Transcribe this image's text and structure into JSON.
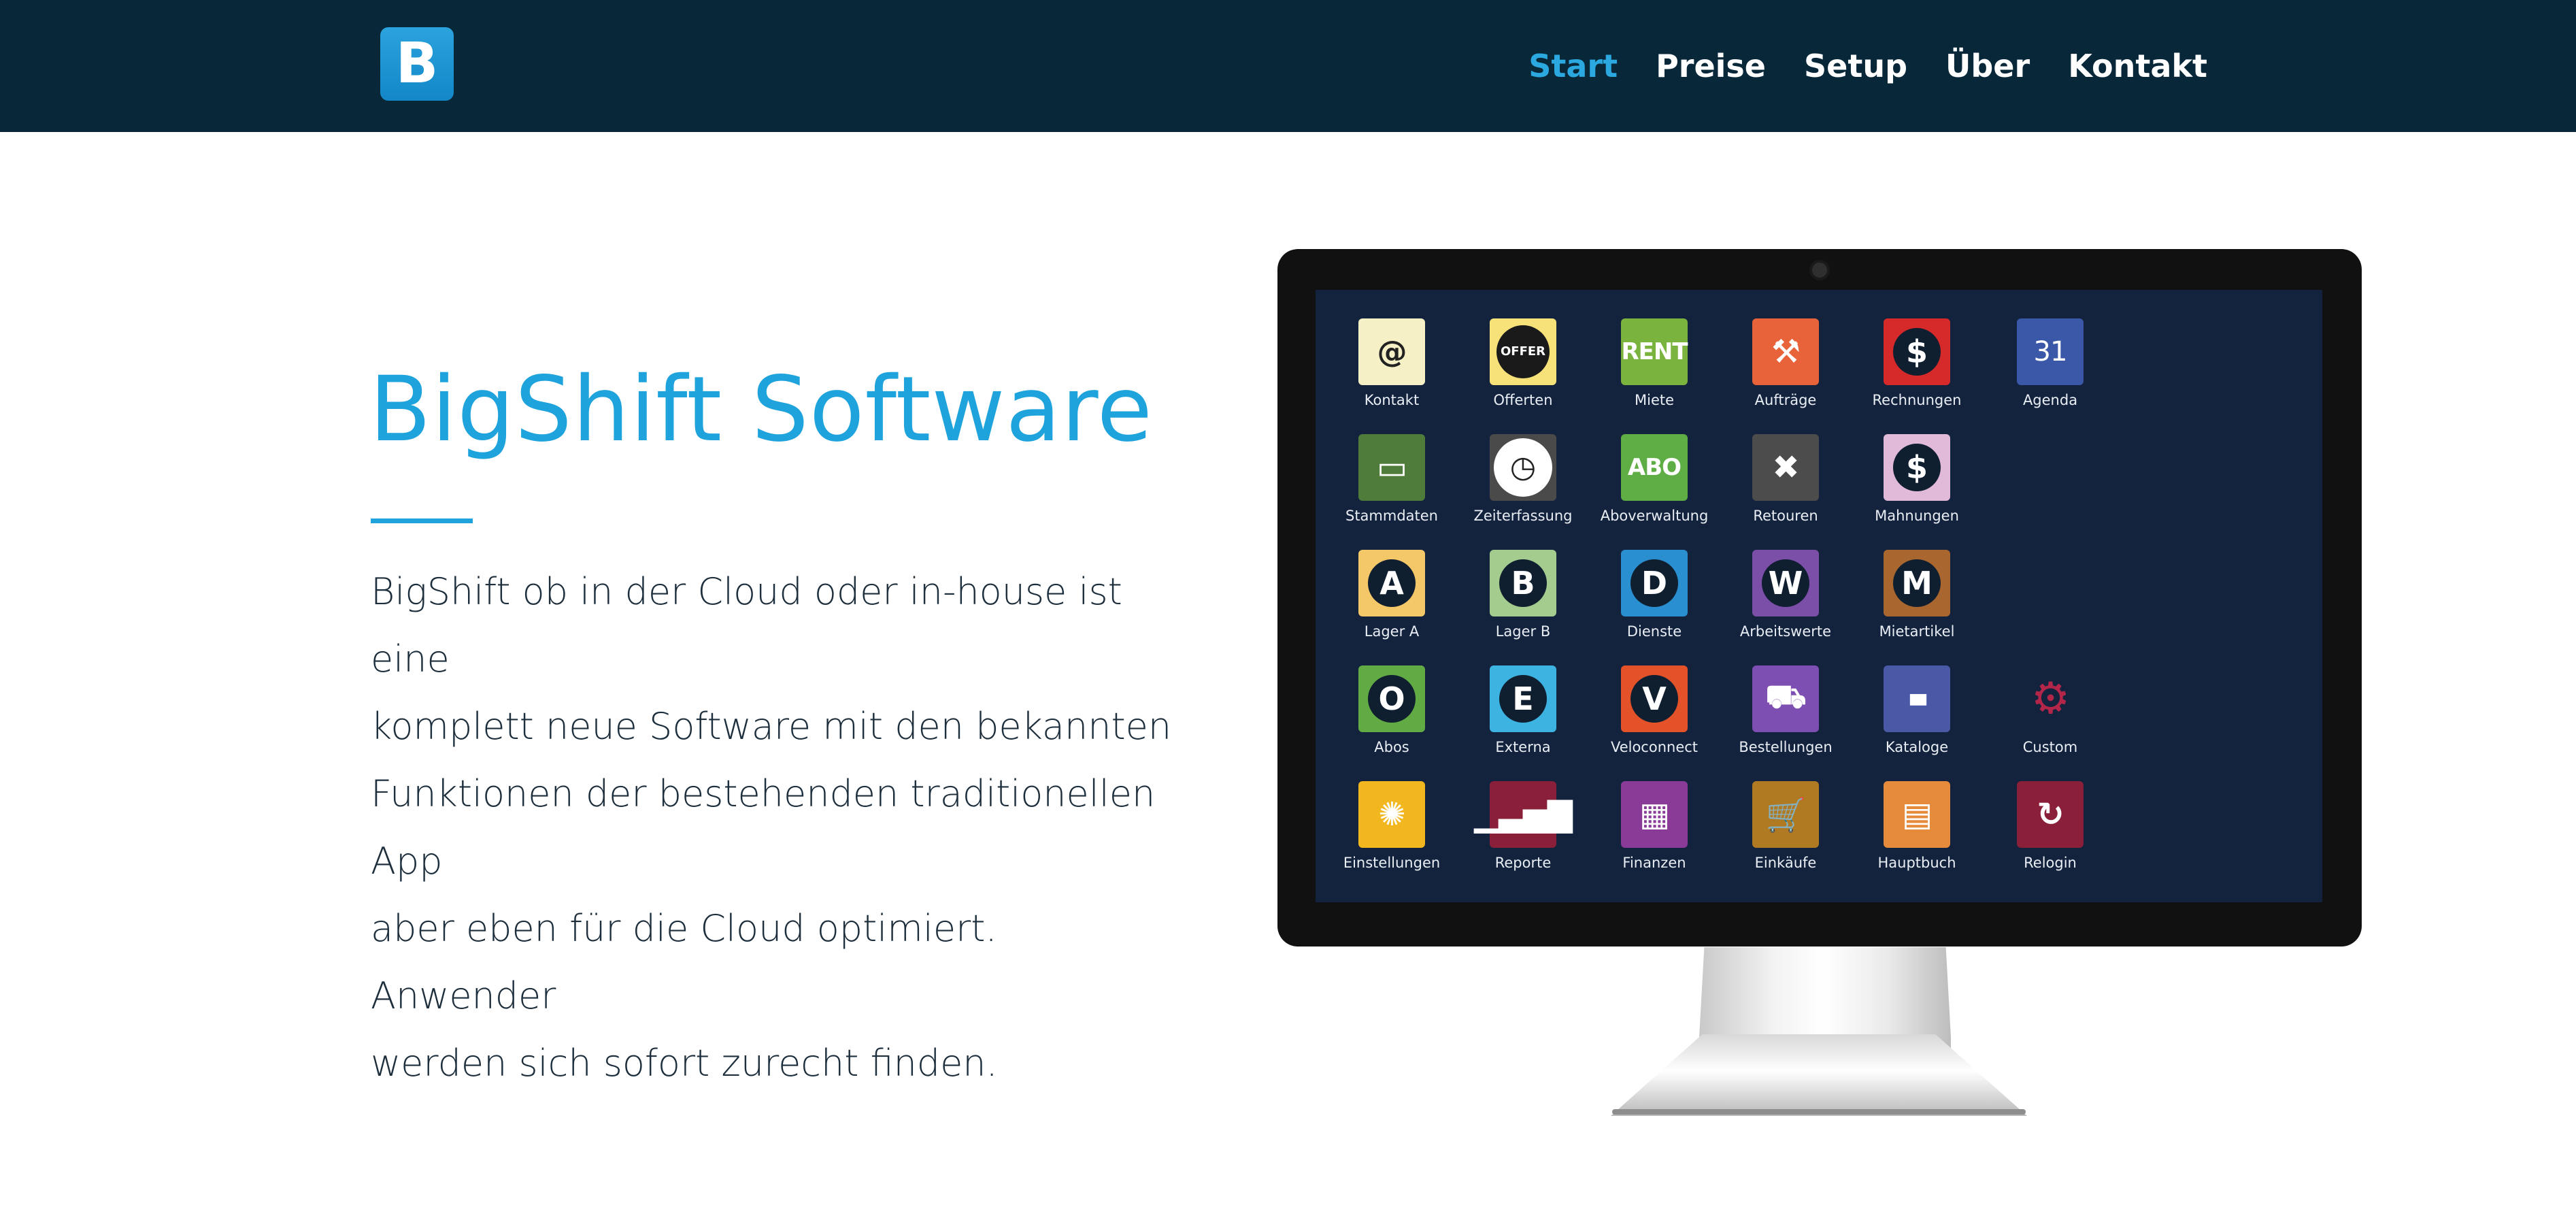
{
  "nav": {
    "logo_letter": "B",
    "items": [
      {
        "label": "Start",
        "active": true
      },
      {
        "label": "Preise",
        "active": false
      },
      {
        "label": "Setup",
        "active": false
      },
      {
        "label": "Über",
        "active": false
      },
      {
        "label": "Kontakt",
        "active": false
      }
    ]
  },
  "hero": {
    "title": "BigShift Software",
    "lines": [
      "BigShift ob in der Cloud oder in-house ist eine",
      "komplett neue Software mit den bekannten",
      "Funktionen der bestehenden traditionellen App",
      "aber eben für die Cloud optimiert. Anwender",
      "werden sich sofort zurecht finden."
    ]
  },
  "apps": {
    "row1": [
      {
        "label": "Kontakt",
        "icon": "contact-card-icon",
        "bg": "#f5f0c6",
        "glyph": "@"
      },
      {
        "label": "Offerten",
        "icon": "offer-seal-icon",
        "bg": "#f7e27a",
        "glyph": "OFFER"
      },
      {
        "label": "Miete",
        "icon": "rent-icon",
        "bg": "#7bb33f",
        "glyph": "RENT"
      },
      {
        "label": "Aufträge",
        "icon": "construction-worker-icon",
        "bg": "#e8623a",
        "glyph": "⚒"
      },
      {
        "label": "Rechnungen",
        "icon": "dollar-icon",
        "bg": "#d62a2a",
        "glyph": "$"
      },
      {
        "label": "Agenda",
        "icon": "calendar-icon",
        "bg": "#3a57a8",
        "glyph": "31"
      }
    ],
    "row2": [
      {
        "label": "Stammdaten",
        "icon": "box-icon",
        "bg": "#4f7c3a",
        "glyph": "▭"
      },
      {
        "label": "Zeiterfassung",
        "icon": "clock-icon",
        "bg": "#4a4a4a",
        "glyph": "◷"
      },
      {
        "label": "Aboverwaltung",
        "icon": "abo-icon",
        "bg": "#5fae45",
        "glyph": "ABO"
      },
      {
        "label": "Retouren",
        "icon": "thumbs-down-icon",
        "bg": "#4c4c4c",
        "glyph": "✖"
      },
      {
        "label": "Mahnungen",
        "icon": "dollar-reminder-icon",
        "bg": "#e1b9d9",
        "glyph": "$"
      }
    ],
    "row3": [
      {
        "label": "Lager A",
        "icon": "letter-a-icon",
        "bg": "#f4c768",
        "glyph": "A"
      },
      {
        "label": "Lager B",
        "icon": "letter-b-icon",
        "bg": "#a3cc8e",
        "glyph": "B"
      },
      {
        "label": "Dienste",
        "icon": "letter-d-icon",
        "bg": "#2a8fd0",
        "glyph": "D"
      },
      {
        "label": "Arbeitswerte",
        "icon": "letter-w-icon",
        "bg": "#7b4fa8",
        "glyph": "W"
      },
      {
        "label": "Mietartikel",
        "icon": "letter-m-icon",
        "bg": "#a9662e",
        "glyph": "M"
      }
    ],
    "row4": [
      {
        "label": "Abos",
        "icon": "letter-o-icon",
        "bg": "#61aa44",
        "glyph": "O"
      },
      {
        "label": "Externa",
        "icon": "letter-e-icon",
        "bg": "#3db3e2",
        "glyph": "E"
      },
      {
        "label": "Veloconnect",
        "icon": "letter-v-icon",
        "bg": "#e4522a",
        "glyph": "V"
      },
      {
        "label": "Bestellungen",
        "icon": "hand-truck-icon",
        "bg": "#7e4fb2",
        "glyph": "⛟"
      },
      {
        "label": "Kataloge",
        "icon": "barcode-icon",
        "bg": "#4a59a6",
        "glyph": "▮▮▮"
      },
      {
        "label": "Custom",
        "icon": "user-gear-icon",
        "bg": "#14233d",
        "glyph": "⚙"
      }
    ],
    "row5": [
      {
        "label": "Einstellungen",
        "icon": "wheel-icon",
        "bg": "#f2b61f",
        "glyph": "✺"
      },
      {
        "label": "Reporte",
        "icon": "chart-up-icon",
        "bg": "#8a1f3a",
        "glyph": "▁▃▅▇"
      },
      {
        "label": "Finanzen",
        "icon": "calculator-icon",
        "bg": "#8a3b98",
        "glyph": "▦"
      },
      {
        "label": "Einkäufe",
        "icon": "cart-icon",
        "bg": "#b07a23",
        "glyph": "🛒"
      },
      {
        "label": "Hauptbuch",
        "icon": "book-icon",
        "bg": "#e68a3c",
        "glyph": "▤"
      },
      {
        "label": "Relogin",
        "icon": "refresh-icon",
        "bg": "#8a1f3a",
        "glyph": "↻"
      }
    ]
  },
  "colors": {
    "header_bg": "#08283a",
    "accent": "#1ea3dc",
    "text": "#1d2e3c",
    "screen_bg": "#14233d"
  }
}
